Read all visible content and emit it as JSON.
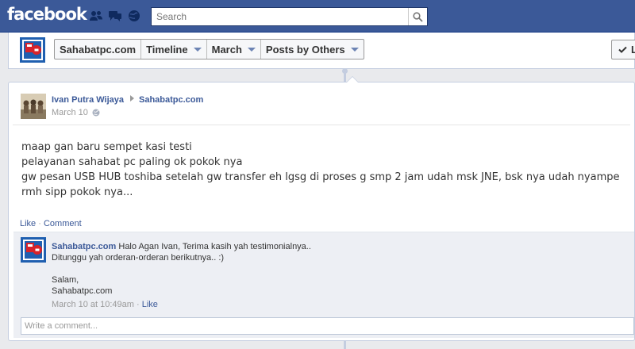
{
  "topbar": {
    "logo": "facebook",
    "search": {
      "placeholder": "Search",
      "value": ""
    },
    "jewels": [
      "friend-requests-icon",
      "messages-icon",
      "notifications-icon"
    ]
  },
  "nav": {
    "page_name": "Sahabatpc.com",
    "timeline": "Timeline",
    "month": "March",
    "filter": "Posts by Others",
    "like_label": "L"
  },
  "post": {
    "author": "Ivan Putra Wijaya",
    "target": "Sahabatpc.com",
    "date": "March 10",
    "body": [
      "maap gan baru sempet kasi testi",
      "pelayanan sahabat pc paling ok pokok nya",
      "gw pesan USB HUB toshiba setelah gw transfer eh lgsg di proses g smp 2 jam udah msk JNE, bsk nya udah nyampe rmh sipp pokok nya..."
    ],
    "actions": {
      "like": "Like",
      "separator": " · ",
      "comment": "Comment"
    }
  },
  "comment": {
    "author": "Sahabatpc.com",
    "lines": [
      "Halo Agan Ivan, Terima kasih yah testimonialnya..",
      "Ditunggu yah orderan-orderan berikutnya.. :)",
      "",
      "Salam,",
      "Sahabatpc.com"
    ],
    "timestamp": "March 10 at 10:49am",
    "separator": " · ",
    "like": "Like"
  },
  "comment_box": {
    "placeholder": "Write a comment..."
  },
  "colors": {
    "brand": "#3b5998",
    "link": "#3b5998",
    "feedback_bg": "#edeff4",
    "page_bg": "#e9eaed",
    "logo_red": "#d8232a",
    "logo_blue": "#1f5fb0"
  }
}
